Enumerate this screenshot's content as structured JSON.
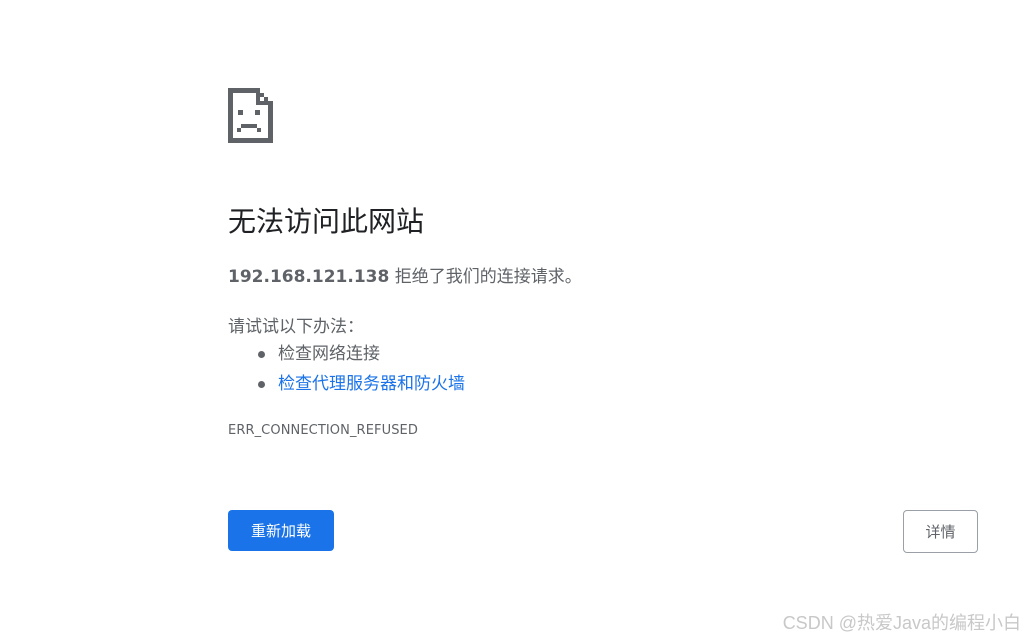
{
  "error_page": {
    "title": "无法访问此网站",
    "host": "192.168.121.138",
    "message_suffix": " 拒绝了我们的连接请求。",
    "try_label": "请试试以下办法：",
    "suggestions": [
      {
        "text": "检查网络连接",
        "is_link": false
      },
      {
        "text": "检查代理服务器和防火墙",
        "is_link": true
      }
    ],
    "error_code": "ERR_CONNECTION_REFUSED",
    "reload_label": "重新加载",
    "details_label": "详情",
    "icon": "sad-page-icon"
  },
  "watermark": "CSDN @热爱Java的编程小白",
  "colors": {
    "primary": "#1a73e8",
    "text": "#5f6368",
    "title": "#202124"
  }
}
